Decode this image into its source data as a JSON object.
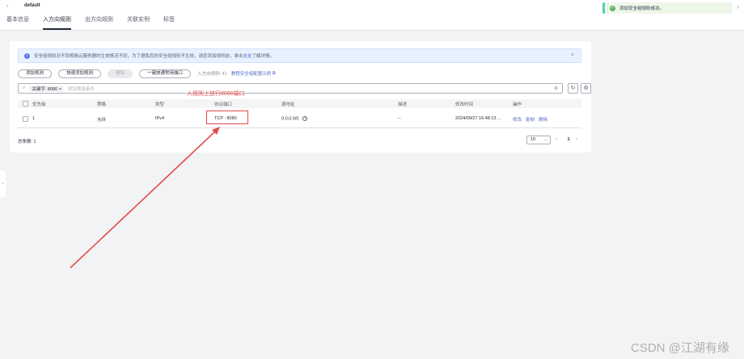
{
  "header": {
    "back_icon": "chevron-left-icon",
    "title": "default",
    "tabs": [
      "基本信息",
      "入方向规则",
      "出方向规则",
      "关联实例",
      "标签"
    ],
    "active_tab": 1
  },
  "toast": {
    "message": "添加安全组规则成功。",
    "color": "#50d4ab"
  },
  "alert": {
    "text": "安全组规则对不同规格云服务器的生效情况不同，为了避免您的安全组规则不生效，请您添加规则前，单击",
    "link": "此处",
    "suffix": "了解详情。"
  },
  "toolbar": {
    "buttons": [
      "添加规则",
      "快速添加规则",
      "删除",
      "一键放通常用端口"
    ],
    "quota": "入方向规则: 41",
    "config_link": "教程安全组配置示例"
  },
  "search": {
    "chip": "关键字: 8080",
    "placeholder": "添加筛选条件"
  },
  "table": {
    "headers": [
      "优先级",
      "策略",
      "类型",
      "协议端口",
      "源地址",
      "描述",
      "修改时间",
      "操作"
    ],
    "rows": [
      {
        "priority": "1",
        "policy": "允许",
        "type": "IPv4",
        "port": "TCP : 8080",
        "source": "0.0.0.0/0",
        "description": "--",
        "modified": "2024/09/27 16:48:13 ...",
        "ops": [
          "修改",
          "复制",
          "删除"
        ]
      }
    ]
  },
  "pagination": {
    "total": "总条数: 1",
    "page_size": "10",
    "current": "1"
  },
  "annotation": {
    "text": "入规则上放行8080端口",
    "color": "#e44a4a"
  },
  "watermark": "CSDN @江湖有缘"
}
